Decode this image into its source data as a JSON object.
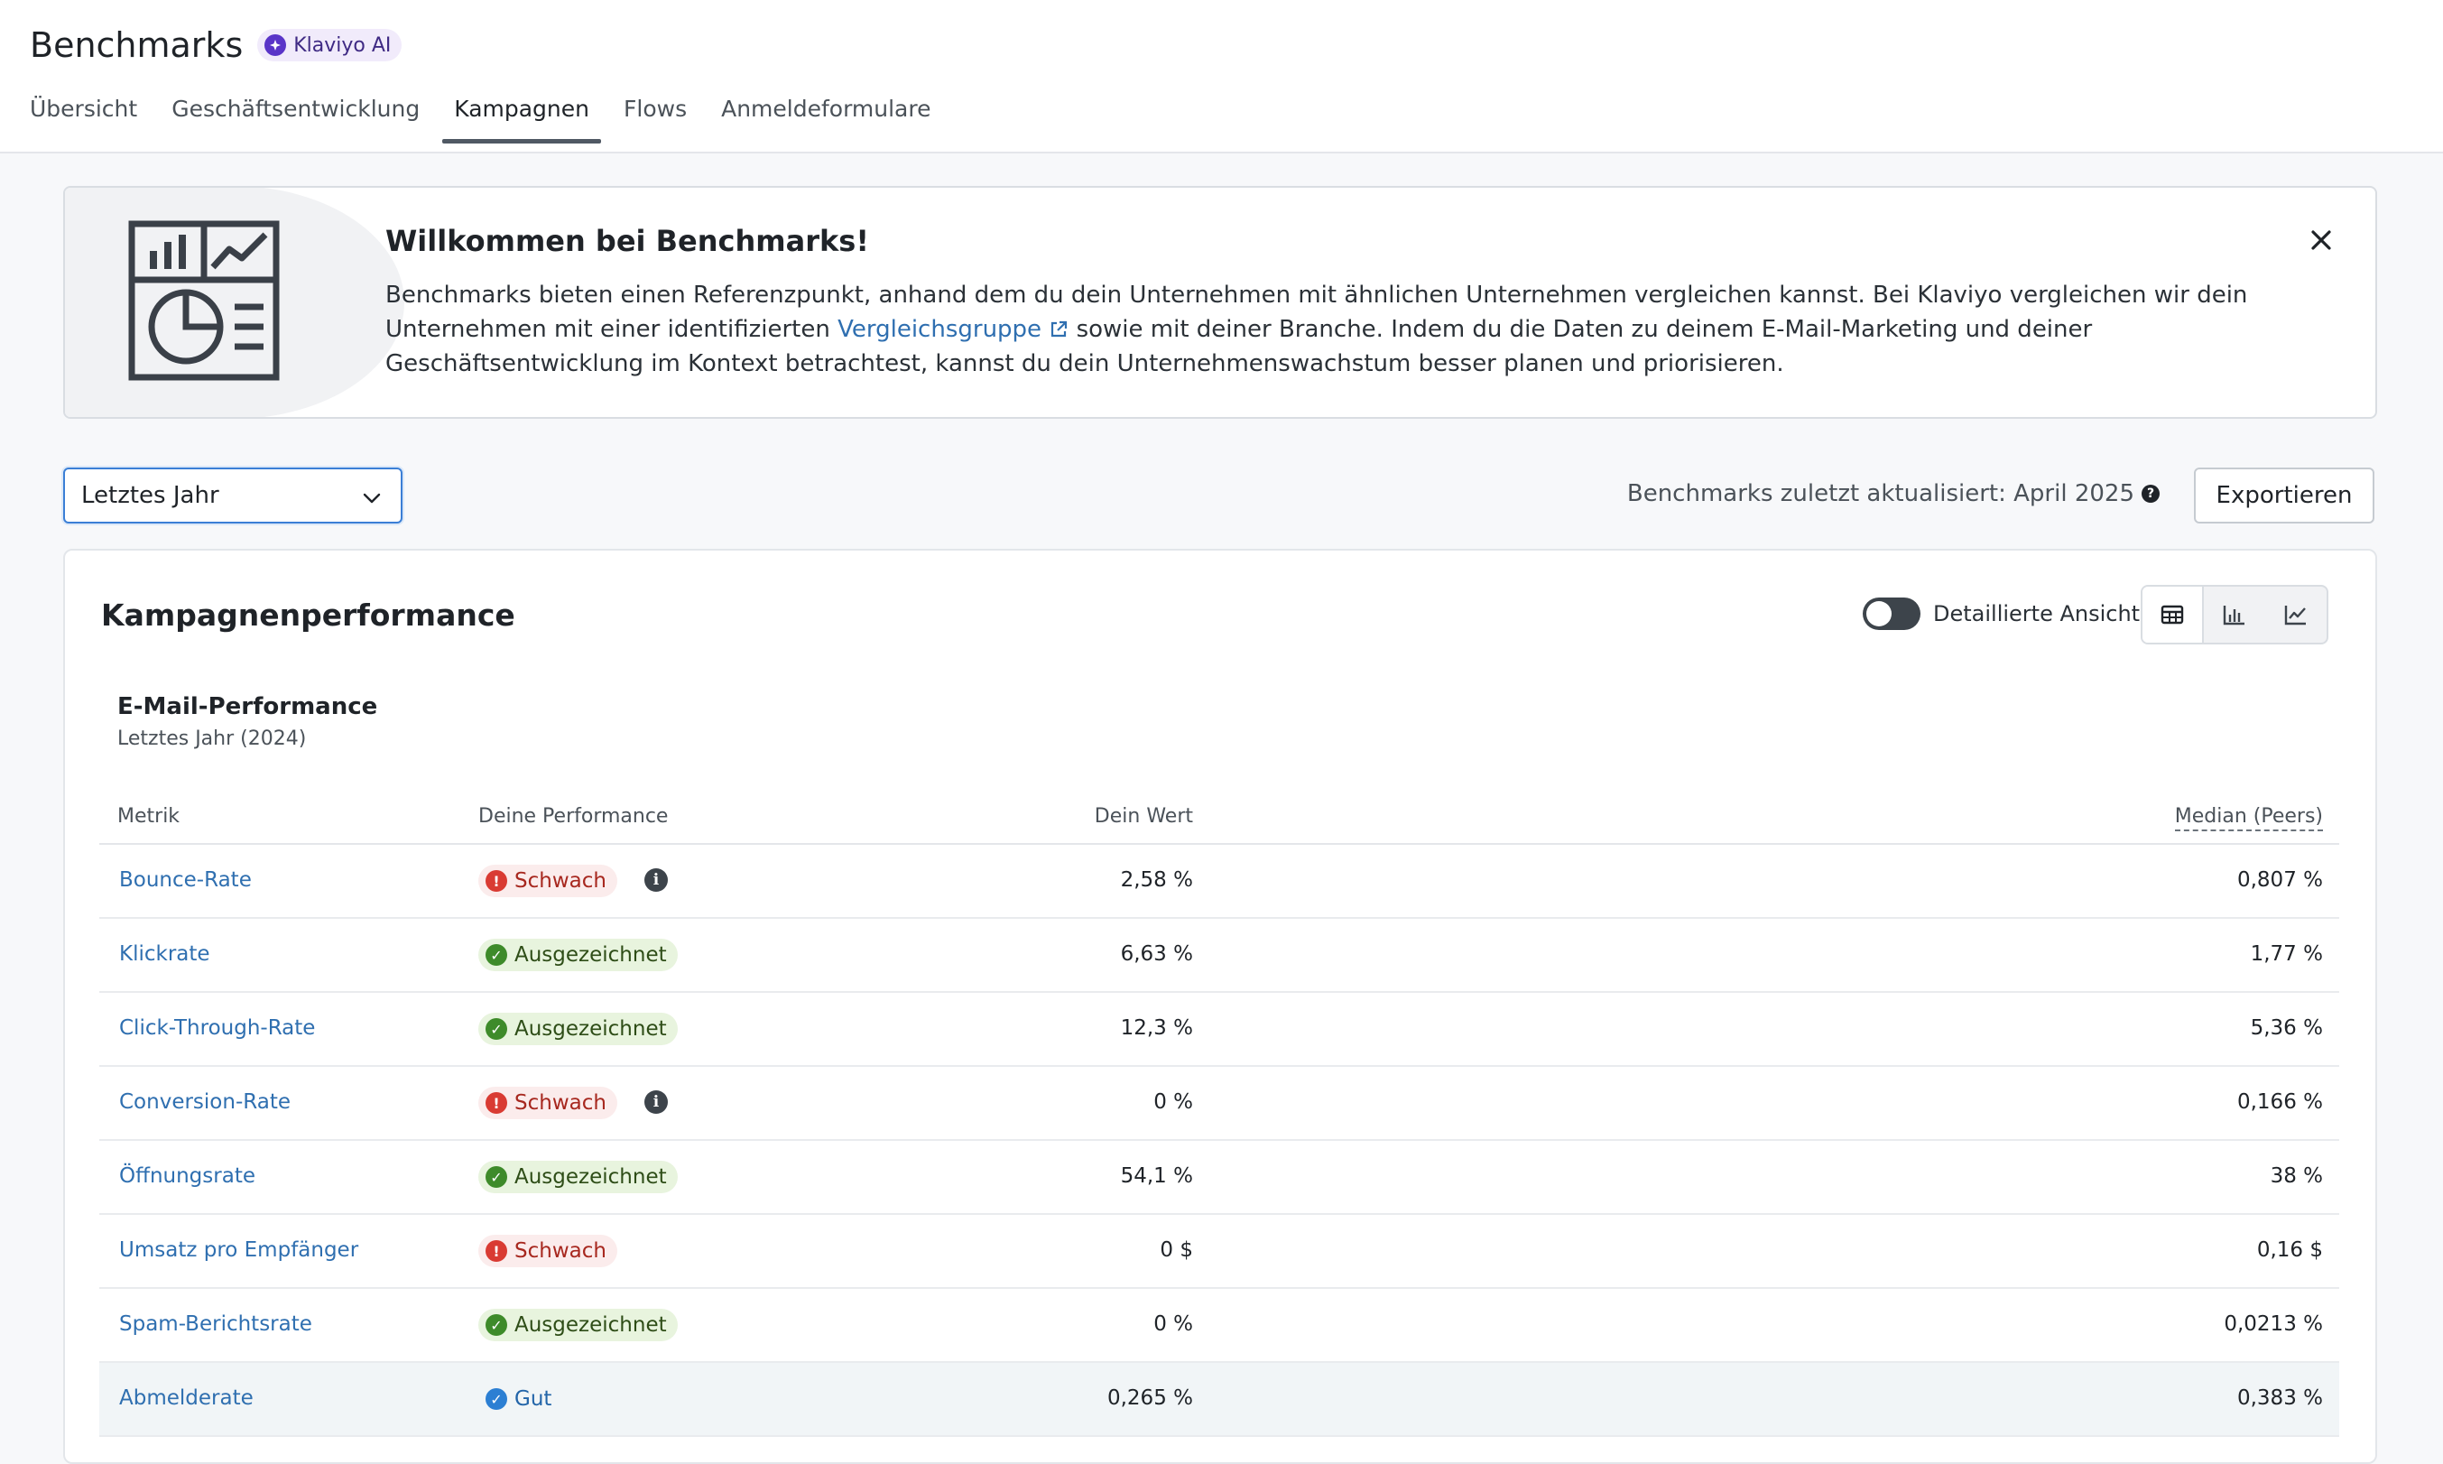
{
  "header": {
    "title": "Benchmarks",
    "ai_badge": "Klaviyo AI",
    "tabs": [
      {
        "label": "Übersicht",
        "active": false
      },
      {
        "label": "Geschäftsentwicklung",
        "active": false
      },
      {
        "label": "Kampagnen",
        "active": true
      },
      {
        "label": "Flows",
        "active": false
      },
      {
        "label": "Anmeldeformulare",
        "active": false
      }
    ]
  },
  "welcome": {
    "title": "Willkommen bei Benchmarks!",
    "body_1": "Benchmarks bieten einen Referenzpunkt, anhand dem du dein Unternehmen mit ähnlichen Unternehmen vergleichen kannst. Bei Klaviyo vergleichen wir dein Unternehmen mit einer identifizierten ",
    "link": "Vergleichsgruppe",
    "body_2": " sowie mit deiner Branche. Indem du die Daten zu deinem E-Mail-Marketing und deiner Geschäftsentwicklung im Kontext betrachtest, kannst du dein Unternehmenswachstum besser planen und priorisieren."
  },
  "controls": {
    "period": "Letztes Jahr",
    "updated": "Benchmarks zuletzt aktualisiert: April 2025",
    "export": "Exportieren"
  },
  "card": {
    "title": "Kampagnenperformance",
    "toggle_label": "Detaillierte Ansicht",
    "section_title": "E-Mail-Performance",
    "section_sub": "Letztes Jahr (2024)",
    "columns": {
      "metric": "Metrik",
      "performance": "Deine Performance",
      "value": "Dein Wert",
      "median": "Median (Peers)"
    },
    "rows": [
      {
        "metric": "Bounce-Rate",
        "performance": "Schwach",
        "value": "2,58 %",
        "median": "0,807 %"
      },
      {
        "metric": "Klickrate",
        "performance": "Ausgezeichnet",
        "value": "6,63 %",
        "median": "1,77 %"
      },
      {
        "metric": "Click-Through-Rate",
        "performance": "Ausgezeichnet",
        "value": "12,3 %",
        "median": "5,36 %"
      },
      {
        "metric": "Conversion-Rate",
        "performance": "Schwach",
        "value": "0 %",
        "median": "0,166 %"
      },
      {
        "metric": "Öffnungsrate",
        "performance": "Ausgezeichnet",
        "value": "54,1 %",
        "median": "38 %"
      },
      {
        "metric": "Umsatz pro Empfänger",
        "performance": "Schwach",
        "value": "0 $",
        "median": "0,16 $"
      },
      {
        "metric": "Spam-Berichtsrate",
        "performance": "Ausgezeichnet",
        "value": "0 %",
        "median": "0,0213 %"
      },
      {
        "metric": "Abmelderate",
        "performance": "Gut",
        "value": "0,265 %",
        "median": "0,383 %"
      }
    ]
  },
  "colors": {
    "accent": "#2f6fb0",
    "weak": "#d93b33",
    "excellent": "#3e8b2a",
    "good": "#2c7fd3"
  }
}
